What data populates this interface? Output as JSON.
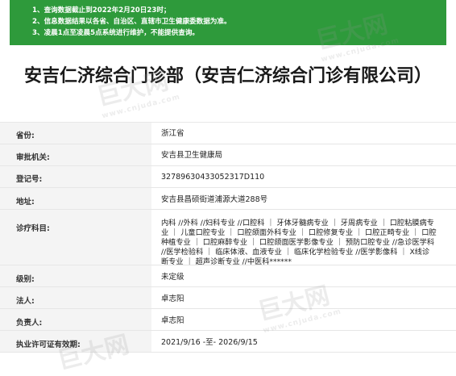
{
  "notice": {
    "lines": [
      "1、查询数据截止到2022年2月20日23时；",
      "2、信息数据结果以各省、自治区、直辖市卫生健康委数据为准。",
      "3、凌晨1点至凌晨5点系统进行维护，不能提供查询。"
    ]
  },
  "title": "安吉仁济综合门诊部（安吉仁济综合门诊有限公司）",
  "fields": [
    {
      "label": "省份:",
      "value": "浙江省"
    },
    {
      "label": "审批机关:",
      "value": "安吉县卫生健康局"
    },
    {
      "label": "登记号:",
      "value": "32789630433052317D110"
    },
    {
      "label": "地址:",
      "value": "安吉县昌硕街道浦源大道288号"
    },
    {
      "label": "诊疗科目:",
      "value": "内科 //外科 //妇科专业 //口腔科 ｜ 牙体牙髓病专业 ｜ 牙周病专业 ｜ 口腔粘膜病专业 ｜ 儿童口腔专业 ｜ 口腔颌面外科专业 ｜ 口腔修复专业 ｜ 口腔正畸专业 ｜ 口腔种植专业 ｜ 口腔麻醉专业 ｜ 口腔颌面医学影像专业 ｜ 预防口腔专业 //急诊医学科 //医学检验科 ｜ 临床体液、血液专业 ｜ 临床化学检验专业 //医学影像科 ｜ X线诊断专业 ｜ 超声诊断专业 //中医科******"
    },
    {
      "label": "级别:",
      "value": "未定级"
    },
    {
      "label": "法人:",
      "value": "卓志阳"
    },
    {
      "label": "负责人:",
      "value": "卓志阳"
    },
    {
      "label": "执业许可证有效期:",
      "value": "2021/9/16 -至- 2026/9/15"
    }
  ],
  "watermark": {
    "text": "巨大网",
    "url": "www.cnjuda.com"
  }
}
